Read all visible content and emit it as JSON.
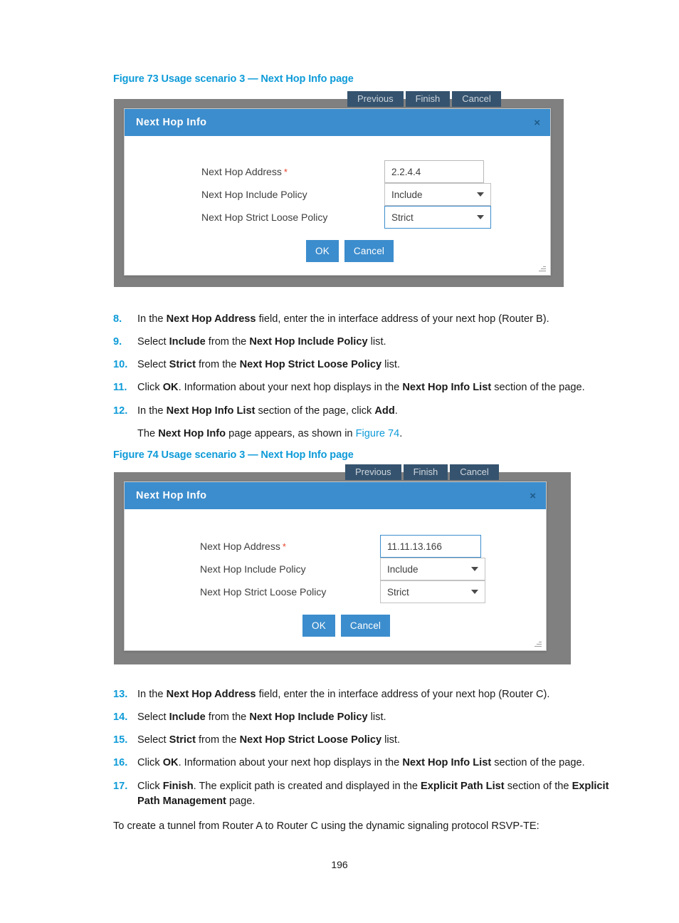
{
  "document": {
    "page_number": "196",
    "closing_paragraph": "To create a tunnel from Router A to Router C using the dynamic signaling protocol RSVP-TE:"
  },
  "figure73": {
    "caption": "Figure 73 Usage scenario 3 — Next Hop Info page",
    "wizard_buttons": [
      "Previous",
      "Finish",
      "Cancel"
    ],
    "dialog": {
      "title": "Next Hop Info",
      "close_icon": "×",
      "fields": [
        {
          "label": "Next Hop Address",
          "required_marker": "*",
          "type": "text",
          "value": "2.2.4.4",
          "focused": false
        },
        {
          "label": "Next Hop Include Policy",
          "required_marker": "",
          "type": "select",
          "value": "Include",
          "focused": false
        },
        {
          "label": "Next Hop Strict Loose Policy",
          "required_marker": "",
          "type": "select",
          "value": "Strict",
          "focused": true
        }
      ],
      "ok_label": "OK",
      "cancel_label": "Cancel"
    }
  },
  "figure74": {
    "caption": "Figure 74 Usage scenario 3 — Next Hop Info page",
    "wizard_buttons": [
      "Previous",
      "Finish",
      "Cancel"
    ],
    "dialog": {
      "title": "Next Hop Info",
      "close_icon": "×",
      "fields": [
        {
          "label": "Next Hop Address",
          "required_marker": "*",
          "type": "text",
          "value": "11.11.13.166",
          "focused": true
        },
        {
          "label": "Next Hop Include Policy",
          "required_marker": "",
          "type": "select",
          "value": "Include",
          "focused": false
        },
        {
          "label": "Next Hop Strict Loose Policy",
          "required_marker": "",
          "type": "select",
          "value": "Strict",
          "focused": false
        }
      ],
      "ok_label": "OK",
      "cancel_label": "Cancel"
    }
  },
  "steps_upper": [
    {
      "num": "8.",
      "html": "In the <b>Next Hop Address</b> field, enter the in interface address of your next hop (Router B)."
    },
    {
      "num": "9.",
      "html": "Select <b>Include</b> from the <b>Next Hop Include Policy</b> list."
    },
    {
      "num": "10.",
      "html": "Select <b>Strict</b> from the <b>Next Hop Strict Loose Policy</b> list."
    },
    {
      "num": "11.",
      "html": "Click <b>OK</b>. Information about your next hop displays in the <b>Next Hop Info List</b> section of the page."
    },
    {
      "num": "12.",
      "html": "In the <b>Next Hop Info List</b> section of the page, click <b>Add</b>."
    }
  ],
  "steps_upper_note": "The <b>Next Hop Info</b> page appears, as shown in <span class=\"xref\">Figure 74</span>.",
  "steps_lower": [
    {
      "num": "13.",
      "html": "In the <b>Next Hop Address</b> field, enter the in interface address of your next hop (Router C)."
    },
    {
      "num": "14.",
      "html": "Select <b>Include</b> from the <b>Next Hop Include Policy</b> list."
    },
    {
      "num": "15.",
      "html": "Select <b>Strict</b> from the <b>Next Hop Strict Loose Policy</b> list."
    },
    {
      "num": "16.",
      "html": "Click <b>OK</b>. Information about your next hop displays in the <b>Next Hop Info List</b> section of the page."
    },
    {
      "num": "17.",
      "html": "Click <b>Finish</b>. The explicit path is created and displayed in the <b>Explicit Path List</b> section of the <b>Explicit Path Management</b> page."
    }
  ],
  "colors": {
    "accent_blue": "#0e9bd8",
    "dialog_blue": "#3c8dcd",
    "wizard_button": "#35536e",
    "figure_frame_gray": "#808080",
    "required_red": "#e8442a"
  }
}
